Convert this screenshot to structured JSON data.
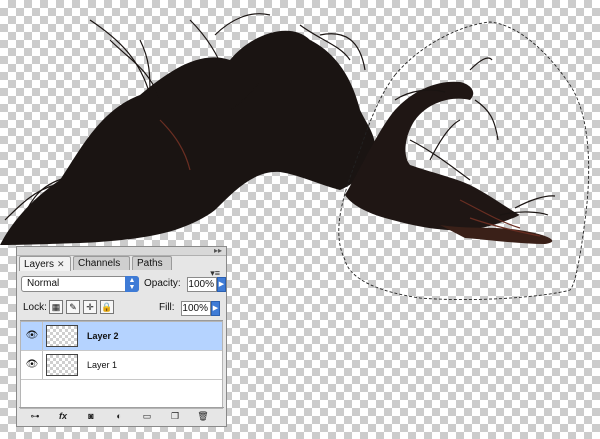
{
  "layers_panel": {
    "tabs": [
      {
        "label": "Layers",
        "close": "✕"
      },
      {
        "label": "Channels"
      },
      {
        "label": "Paths"
      }
    ],
    "blend_mode": "Normal",
    "opacity_label": "Opacity:",
    "opacity_value": "100%",
    "lock_label": "Lock:",
    "fill_label": "Fill:",
    "fill_value": "100%",
    "layers": [
      {
        "name": "Layer 2",
        "selected": true
      },
      {
        "name": "Layer 1",
        "selected": false
      }
    ]
  },
  "icons": {
    "eye": "eye-icon",
    "lock_transparent": "checker-lock-icon",
    "lock_image": "brush-lock-icon",
    "lock_position": "move-lock-icon",
    "lock_all": "padlock-icon",
    "bottom_buttons": [
      "link-icon",
      "fx-icon",
      "mask-icon",
      "adjustment-icon",
      "folder-icon",
      "new-layer-icon",
      "trash-icon"
    ]
  },
  "colors": {
    "selection_highlight": "#b5d3ff",
    "accent_blue": "#3e7bd6",
    "hair": "#1a1412"
  }
}
